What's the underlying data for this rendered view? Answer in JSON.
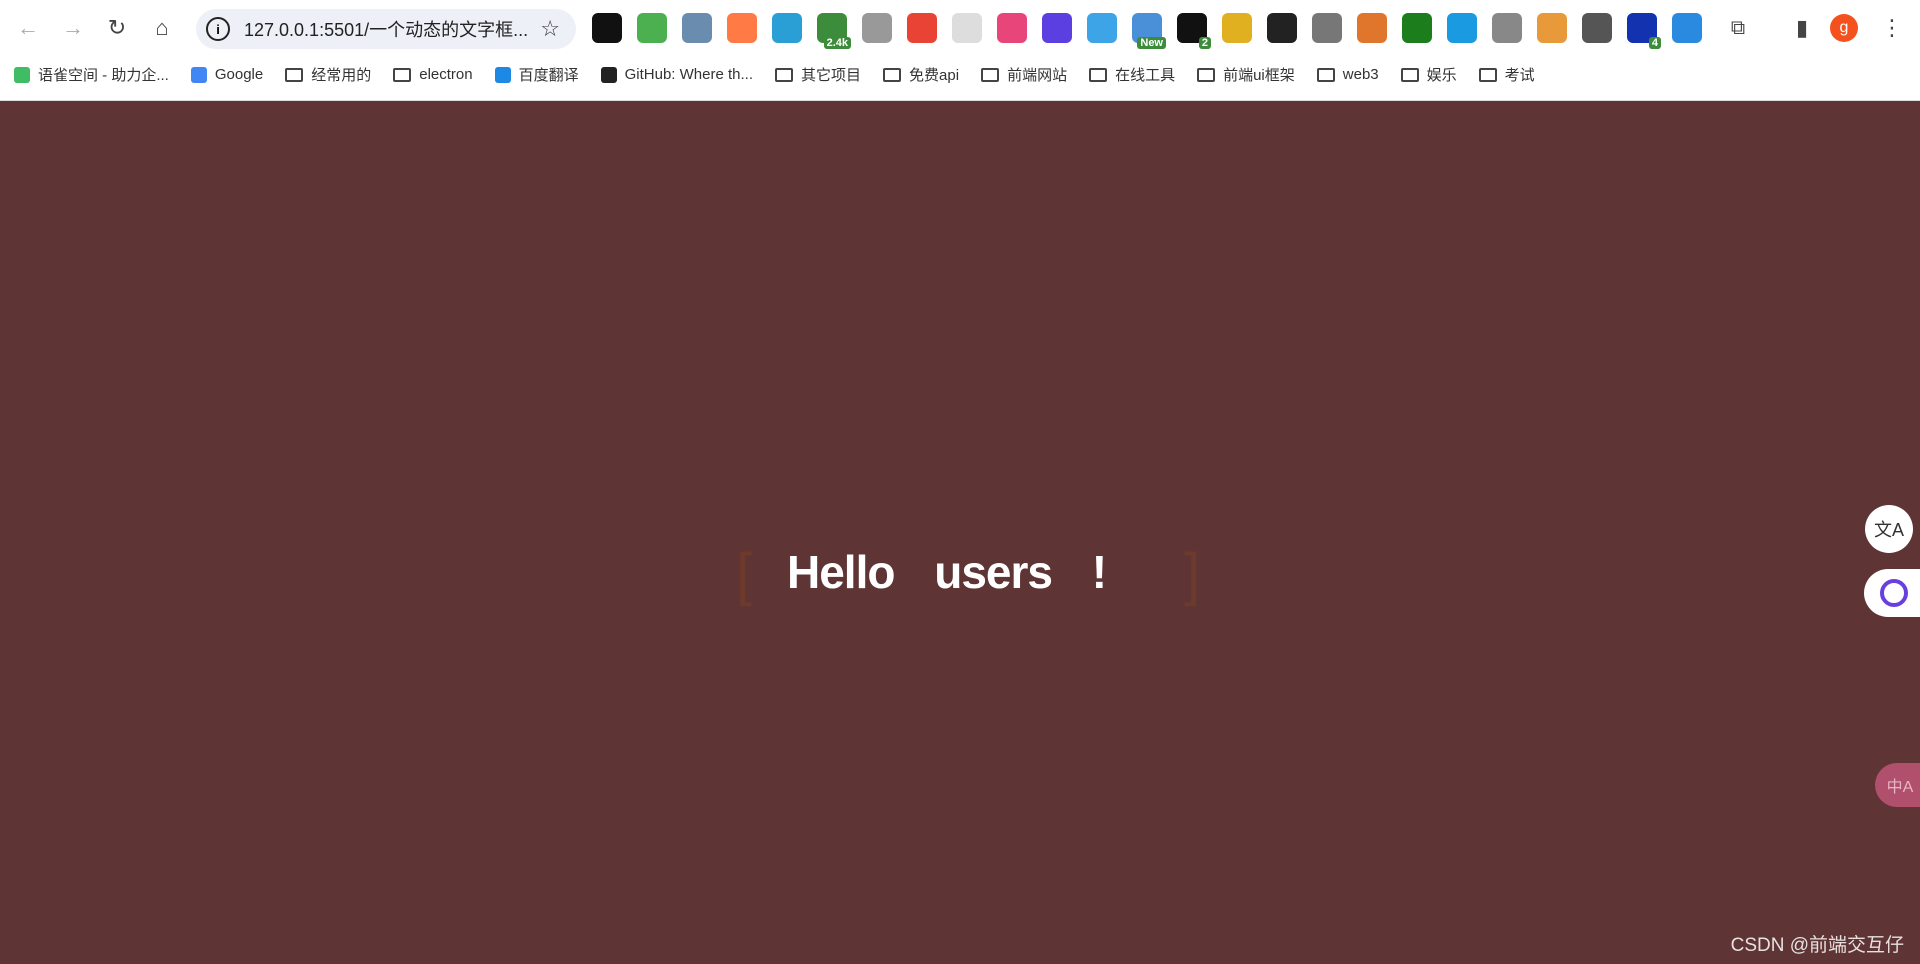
{
  "browser": {
    "url": "127.0.0.1:5501/一个动态的文字框...",
    "extensions": [
      {
        "name": "ext-1",
        "color": "#111"
      },
      {
        "name": "ext-2",
        "color": "#4caf50"
      },
      {
        "name": "ext-3",
        "color": "#6a8caf"
      },
      {
        "name": "ext-4",
        "color": "#ff7a45"
      },
      {
        "name": "ext-5",
        "color": "#2a9fd6"
      },
      {
        "name": "ext-6",
        "color": "#3c8c3c",
        "badge": "2.4k"
      },
      {
        "name": "ext-7",
        "color": "#999"
      },
      {
        "name": "ext-8",
        "color": "#e84335"
      },
      {
        "name": "ext-9",
        "color": "#ddd"
      },
      {
        "name": "ext-10",
        "color": "#e8457a"
      },
      {
        "name": "ext-11",
        "color": "#5b3fe0"
      },
      {
        "name": "ext-12",
        "color": "#3da4e8"
      },
      {
        "name": "ext-13",
        "color": "#4a90d9",
        "badge": "New"
      },
      {
        "name": "ext-14",
        "color": "#111",
        "badge": "2"
      },
      {
        "name": "ext-15",
        "color": "#e0b020"
      },
      {
        "name": "ext-16",
        "color": "#222"
      },
      {
        "name": "ext-17",
        "color": "#777"
      },
      {
        "name": "ext-18",
        "color": "#e0762b"
      },
      {
        "name": "ext-19",
        "color": "#1b7d1b"
      },
      {
        "name": "ext-20",
        "color": "#1a9ae0"
      },
      {
        "name": "ext-21",
        "color": "#888"
      },
      {
        "name": "ext-22",
        "color": "#e89a3a"
      },
      {
        "name": "ext-23",
        "color": "#555"
      },
      {
        "name": "ext-24",
        "color": "#1232b0",
        "badge": "4"
      },
      {
        "name": "ext-25",
        "color": "#2a8ae0"
      }
    ],
    "profile_initial": "g",
    "bookmarks": [
      {
        "label": "语雀空间 - 助力企...",
        "icon": "yuque-icon"
      },
      {
        "label": "Google",
        "icon": "google-icon"
      },
      {
        "label": "经常用的",
        "icon": "folder-icon"
      },
      {
        "label": "electron",
        "icon": "folder-icon"
      },
      {
        "label": "百度翻译",
        "icon": "baidu-translate-icon"
      },
      {
        "label": "GitHub: Where th...",
        "icon": "github-icon"
      },
      {
        "label": "其它项目",
        "icon": "folder-icon"
      },
      {
        "label": "免费api",
        "icon": "folder-icon"
      },
      {
        "label": "前端网站",
        "icon": "folder-icon"
      },
      {
        "label": "在线工具",
        "icon": "folder-icon"
      },
      {
        "label": "前端ui框架",
        "icon": "folder-icon"
      },
      {
        "label": "web3",
        "icon": "folder-icon"
      },
      {
        "label": "娱乐",
        "icon": "folder-icon"
      },
      {
        "label": "考试",
        "icon": "folder-icon"
      }
    ]
  },
  "page": {
    "background": "#5e3435",
    "bracket_left": "[",
    "bracket_right": "]",
    "text": "Hello users !",
    "watermark": "CSDN @前端交互仔"
  },
  "floating": {
    "translate": "文A",
    "translate2": "中A"
  }
}
